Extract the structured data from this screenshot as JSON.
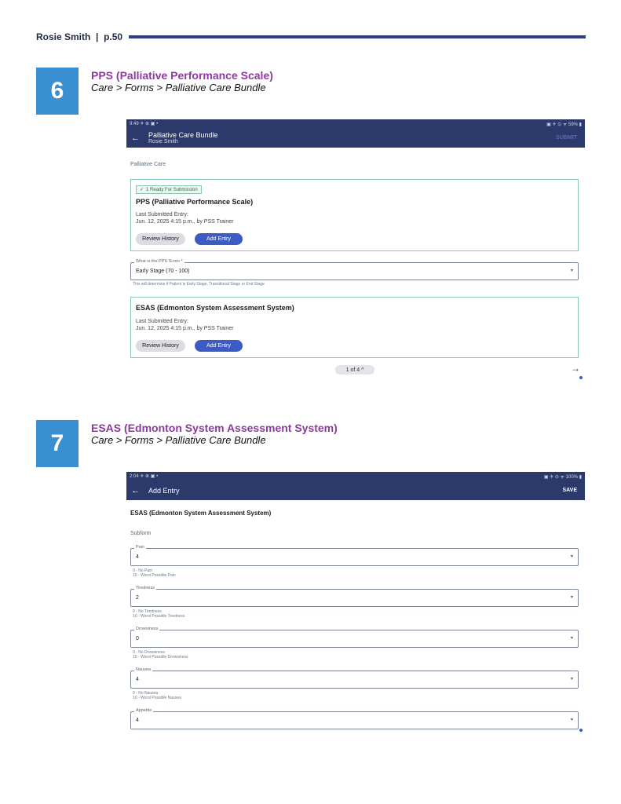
{
  "page": {
    "author": "Rosie Smith",
    "separator": "|",
    "page_num": "p.50",
    "accent_color": "#2d3e8c"
  },
  "step6": {
    "number": "6",
    "title": "PPS (Palliative Performance Scale)",
    "path": "Care > Forms > Palliative Care Bundle",
    "screen": {
      "status_left": "9:49 ✈ ⊕ ▣ •",
      "status_right": "▣ ✈ ⊙ ᯤ 59% ▮",
      "back_icon": "arrow-left",
      "title": "Palliative Care Bundle",
      "subtitle": "Rosie Smith",
      "action": "SUBMIT",
      "section": "Palliative Care",
      "card1": {
        "badge": "1 Ready For Submission",
        "title": "PPS (Palliative Performance Scale)",
        "last_label": "Last Submitted Entry:",
        "last_value": "Jun. 12, 2025 4:15 p.m., by PSS Trainer",
        "review_btn": "Review History",
        "add_btn": "Add Entry"
      },
      "select": {
        "label": "What is the PPS Score *",
        "value": "Early Stage (70 - 100)",
        "hint": "This will determine if Patient is Early Stage, Transitional Stage or End Stage"
      },
      "card2": {
        "title": "ESAS (Edmonton System Assessment System)",
        "last_label": "Last Submitted Entry:",
        "last_value": "Jun. 12, 2025 4:15 p.m., by PSS Trainer",
        "review_btn": "Review History",
        "add_btn": "Add Entry"
      },
      "pager": "1 of 4  ^",
      "next_icon": "→"
    }
  },
  "step7": {
    "number": "7",
    "title": "ESAS (Edmonton System Assessment System)",
    "path": "Care > Forms > Palliative Care Bundle",
    "screen": {
      "status_left": "2:04 ✈ ⊕ ▣ •",
      "status_right": "▣ ✈ ⊙ ᯤ 100% ▮",
      "title": "Add Entry",
      "action": "SAVE",
      "form_title": "ESAS (Edmonton System Assessment System)",
      "section": "Subform",
      "fields": [
        {
          "label": "Pain",
          "value": "4",
          "hint1": "0 - No Pain",
          "hint2": "10 - Worst Possible Pain"
        },
        {
          "label": "Tiredness",
          "value": "2",
          "hint1": "0 - No Tiredness",
          "hint2": "10 - Worst Possible Tiredness"
        },
        {
          "label": "Drowsiness",
          "value": "0",
          "hint1": "0 - No Drowsiness",
          "hint2": "10 - Worst Possible Drowsiness"
        },
        {
          "label": "Nausea",
          "value": "4",
          "hint1": "0 - No Nausea",
          "hint2": "10 - Worst Possible Nausea"
        },
        {
          "label": "Appetite",
          "value": "4",
          "hint1": "",
          "hint2": ""
        }
      ]
    }
  }
}
